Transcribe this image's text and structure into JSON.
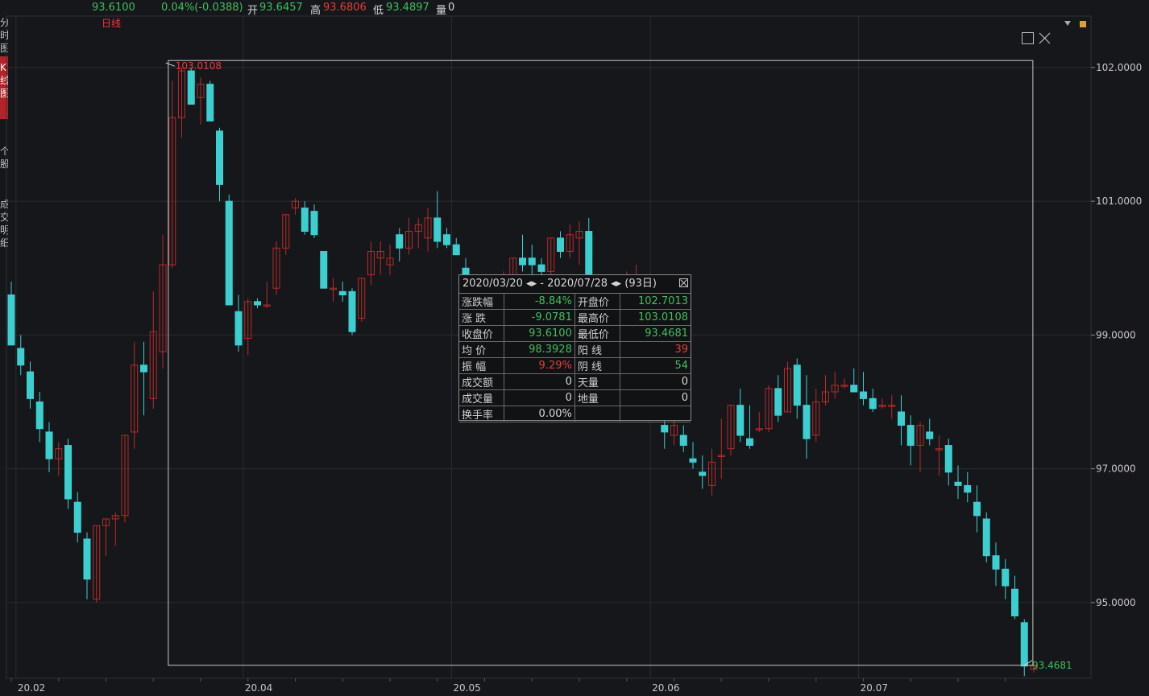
{
  "quote_bar": {
    "price": "93.6100",
    "change": "0.04%(-0.0388)",
    "open_label": "开",
    "open_value": "93.6457",
    "high_label": "高",
    "high_value": "93.6806",
    "low_label": "低",
    "low_value": "93.4897",
    "volume_label": "量",
    "volume_value": "0"
  },
  "left_tabs": [
    {
      "label": "分时图",
      "active": false
    },
    {
      "label": "K线图",
      "active": true
    },
    {
      "label": "个股",
      "active": false
    },
    {
      "label": "成交明细",
      "active": false
    }
  ],
  "period_label": "日线",
  "stats_panel": {
    "range": "2020/03/20 ◂▸ - 2020/07/28 ◂▸ (93日)",
    "rows": [
      [
        "涨跌幅",
        "-8.84%",
        "开盘价",
        "102.7013"
      ],
      [
        "涨  跌",
        "-9.0781",
        "最高价",
        "103.0108"
      ],
      [
        "收盘价",
        "93.6100",
        "最低价",
        "93.4681"
      ],
      [
        "均  价",
        "98.3928",
        "阳  线",
        "39"
      ],
      [
        "振  幅",
        "9.29%",
        "阴  线",
        "54"
      ],
      [
        "成交额",
        "0",
        "天量",
        "0"
      ],
      [
        "成交量",
        "0",
        "地量",
        "0"
      ],
      [
        "换手率",
        "0.00%",
        "",
        ""
      ]
    ],
    "colors": [
      [
        "g",
        "g"
      ],
      [
        "g",
        "g"
      ],
      [
        "g",
        "g"
      ],
      [
        "g",
        "r"
      ],
      [
        "r",
        "g"
      ],
      [
        "w",
        "w"
      ],
      [
        "w",
        "w"
      ],
      [
        "w",
        "w"
      ]
    ]
  },
  "colors": {
    "up": "#b82a2a",
    "down": "#3ccfcf",
    "grid": "#2a2c31",
    "selection": "#c8c8c8",
    "high_label": "#ea3b3b",
    "low_label": "#3fbf5f"
  },
  "chart_data": {
    "type": "candlestick",
    "ylim": [
      93.0,
      102.6
    ],
    "y_ticks": [
      "102.0000",
      "101.0000",
      "99.0000",
      "97.0000",
      "95.0000"
    ],
    "y_tick_values": [
      102,
      100,
      98,
      96,
      94
    ],
    "x_tick_labels": [
      "20.02",
      "20.04",
      "20.05",
      "20.06",
      "20.07"
    ],
    "x_tick_index": [
      0,
      24,
      46,
      67,
      89
    ],
    "selection_range": [
      16,
      108
    ],
    "annotations": {
      "high_label": "103.0108",
      "high_value": 101.96,
      "high_index": 17,
      "low_label": "93.4681",
      "low_value": 93.17,
      "low_index": 108
    },
    "candles": [
      [
        98.6,
        98.8,
        98.6,
        97.85
      ],
      [
        97.8,
        98.0,
        97.4,
        97.55
      ],
      [
        97.45,
        97.6,
        96.9,
        97.05
      ],
      [
        97.0,
        97.15,
        96.4,
        96.6
      ],
      [
        96.55,
        96.7,
        95.95,
        96.15
      ],
      [
        96.15,
        96.4,
        95.9,
        96.3
      ],
      [
        96.35,
        96.45,
        95.4,
        95.55
      ],
      [
        95.5,
        95.65,
        94.9,
        95.05
      ],
      [
        94.95,
        95.05,
        94.05,
        94.35
      ],
      [
        94.05,
        95.15,
        94.0,
        95.15
      ],
      [
        95.15,
        95.25,
        94.7,
        95.25
      ],
      [
        95.25,
        95.35,
        94.85,
        95.3
      ],
      [
        95.3,
        96.5,
        95.2,
        96.5
      ],
      [
        96.55,
        97.9,
        96.3,
        97.55
      ],
      [
        97.55,
        97.9,
        96.8,
        97.45
      ],
      [
        97.05,
        98.65,
        96.9,
        98.05
      ],
      [
        97.75,
        99.5,
        97.5,
        99.05
      ],
      [
        99.05,
        101.8,
        99.0,
        101.25
      ],
      [
        101.25,
        102.0,
        100.95,
        101.95
      ],
      [
        101.95,
        102.0,
        101.55,
        101.45
      ],
      [
        101.55,
        101.85,
        101.15,
        101.75
      ],
      [
        101.75,
        101.8,
        101.4,
        101.2
      ],
      [
        101.05,
        101.1,
        100.0,
        100.25
      ],
      [
        100.0,
        100.1,
        98.45,
        98.45
      ],
      [
        98.35,
        98.6,
        97.75,
        97.85
      ],
      [
        97.95,
        98.55,
        97.7,
        98.5
      ],
      [
        98.5,
        98.55,
        98.4,
        98.45
      ],
      [
        98.45,
        98.8,
        98.4,
        98.45
      ],
      [
        98.7,
        99.4,
        98.6,
        99.3
      ],
      [
        99.3,
        99.8,
        99.2,
        99.8
      ],
      [
        99.9,
        100.05,
        99.8,
        100.0
      ],
      [
        99.9,
        100.0,
        99.5,
        99.55
      ],
      [
        99.85,
        99.95,
        99.45,
        99.5
      ],
      [
        99.25,
        99.25,
        98.7,
        98.7
      ],
      [
        98.7,
        98.85,
        98.5,
        98.7
      ],
      [
        98.65,
        98.8,
        98.5,
        98.6
      ],
      [
        98.65,
        98.7,
        98.0,
        98.05
      ],
      [
        98.25,
        98.85,
        98.2,
        98.85
      ],
      [
        98.9,
        99.4,
        98.75,
        99.25
      ],
      [
        99.15,
        99.4,
        98.9,
        99.25
      ],
      [
        99.05,
        99.35,
        98.9,
        99.15
      ],
      [
        99.5,
        99.6,
        99.1,
        99.3
      ],
      [
        99.3,
        99.75,
        99.2,
        99.55
      ],
      [
        99.55,
        99.75,
        99.3,
        99.65
      ],
      [
        99.45,
        99.9,
        99.25,
        99.75
      ],
      [
        99.75,
        100.15,
        99.3,
        99.4
      ],
      [
        99.5,
        99.6,
        99.3,
        99.35
      ],
      [
        99.35,
        99.45,
        99.2,
        99.2
      ],
      [
        99.0,
        99.15,
        98.5,
        98.55
      ],
      [
        98.5,
        98.6,
        98.05,
        98.05
      ],
      [
        98.05,
        98.1,
        97.35,
        97.6
      ],
      [
        97.6,
        98.2,
        97.5,
        98.15
      ],
      [
        98.2,
        98.95,
        98.1,
        98.75
      ],
      [
        98.75,
        99.15,
        98.6,
        99.15
      ],
      [
        99.15,
        99.5,
        98.95,
        99.05
      ],
      [
        99.15,
        99.35,
        98.85,
        99.05
      ],
      [
        99.05,
        99.15,
        98.85,
        98.95
      ],
      [
        98.95,
        99.45,
        98.8,
        99.45
      ],
      [
        99.45,
        99.55,
        99.15,
        99.25
      ],
      [
        99.25,
        99.65,
        99.15,
        99.5
      ],
      [
        99.45,
        99.7,
        99.05,
        99.55
      ],
      [
        99.55,
        99.75,
        98.95,
        98.45
      ],
      [
        98.75,
        98.8,
        98.4,
        98.7
      ],
      [
        98.7,
        98.75,
        98.4,
        98.7
      ],
      [
        98.7,
        98.85,
        98.5,
        98.65
      ],
      [
        98.6,
        98.95,
        98.55,
        98.75
      ],
      [
        98.75,
        99.05,
        98.6,
        98.85
      ],
      [
        98.85,
        98.9,
        98.35,
        98.4
      ],
      [
        98.1,
        98.15,
        97.45,
        97.45
      ],
      [
        96.65,
        96.8,
        96.3,
        96.55
      ],
      [
        96.5,
        96.85,
        96.35,
        96.65
      ],
      [
        96.5,
        96.65,
        96.25,
        96.35
      ],
      [
        96.15,
        96.4,
        96.0,
        96.1
      ],
      [
        95.95,
        96.2,
        95.7,
        95.9
      ],
      [
        95.75,
        96.3,
        95.6,
        96.1
      ],
      [
        96.2,
        96.75,
        95.85,
        96.2
      ],
      [
        96.3,
        96.95,
        96.2,
        96.95
      ],
      [
        96.95,
        97.2,
        96.4,
        96.5
      ],
      [
        96.45,
        96.95,
        96.3,
        96.35
      ],
      [
        96.6,
        96.85,
        96.55,
        96.6
      ],
      [
        96.6,
        97.25,
        96.55,
        97.2
      ],
      [
        97.2,
        97.4,
        96.7,
        96.8
      ],
      [
        96.85,
        97.6,
        96.85,
        97.5
      ],
      [
        97.55,
        97.65,
        96.75,
        96.95
      ],
      [
        96.95,
        97.4,
        96.15,
        96.45
      ],
      [
        96.5,
        97.2,
        96.4,
        97.0
      ],
      [
        97.0,
        97.4,
        96.95,
        97.15
      ],
      [
        97.15,
        97.45,
        97.05,
        97.25
      ],
      [
        97.25,
        97.35,
        97.2,
        97.25
      ],
      [
        97.25,
        97.5,
        97.15,
        97.15
      ],
      [
        97.15,
        97.45,
        96.95,
        97.05
      ],
      [
        97.05,
        97.2,
        96.85,
        96.9
      ],
      [
        96.95,
        97.05,
        96.9,
        96.95
      ],
      [
        96.95,
        97.1,
        96.75,
        96.95
      ],
      [
        96.85,
        97.1,
        96.35,
        96.65
      ],
      [
        96.65,
        96.8,
        96.05,
        96.35
      ],
      [
        96.35,
        96.7,
        95.95,
        96.65
      ],
      [
        96.55,
        96.75,
        96.35,
        96.45
      ],
      [
        96.3,
        96.5,
        95.9,
        96.3
      ],
      [
        96.35,
        96.45,
        95.75,
        95.95
      ],
      [
        95.8,
        96.05,
        95.55,
        95.75
      ],
      [
        95.75,
        95.95,
        95.5,
        95.65
      ],
      [
        95.5,
        95.75,
        95.05,
        95.3
      ],
      [
        95.25,
        95.35,
        94.6,
        94.7
      ],
      [
        94.7,
        94.9,
        94.25,
        94.5
      ],
      [
        94.5,
        94.65,
        94.05,
        94.25
      ],
      [
        94.2,
        94.4,
        93.75,
        93.8
      ],
      [
        93.7,
        93.75,
        92.9,
        93.05
      ],
      [
        93.0,
        93.1,
        92.95,
        93.05
      ]
    ]
  }
}
